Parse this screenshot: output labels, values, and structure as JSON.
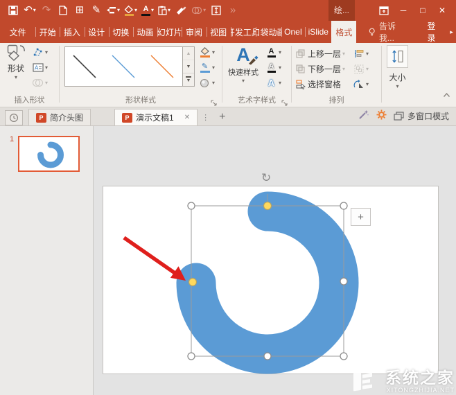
{
  "window": {
    "context_tab_title": "绘...",
    "controls": {
      "minimize": "─",
      "maximize": "□",
      "close": "✕"
    }
  },
  "icons": {
    "dropdown": "▾",
    "undo": "↶",
    "redo": "↷",
    "grid": "⊞",
    "eyedropper": "✎",
    "pencil": "✎",
    "chevrons": "»",
    "scroll_up": "▲",
    "scroll_down": "▼",
    "rotate": "↻",
    "plus": "+",
    "add_tab": "+",
    "close_tab": "✕",
    "more_vert": "⋮",
    "arrow_right": "▸",
    "collapse": "⌃",
    "letter_a": "A"
  },
  "menu": {
    "file": "文件",
    "tabs": [
      "开始",
      "插入",
      "设计",
      "切换",
      "动画",
      "幻灯片",
      "审阅",
      "视图",
      "开发工具",
      "口袋动画",
      "OneI",
      "iSlide"
    ],
    "active_tab": "格式",
    "tell_me": "告诉我...",
    "sign_in": "登录"
  },
  "ribbon": {
    "insert_shapes": {
      "label": "插入形状",
      "shapes_button": "形状"
    },
    "shape_styles": {
      "label": "形状样式"
    },
    "wordart": {
      "label": "艺术字样式",
      "quick_styles": "快速样式"
    },
    "arrange": {
      "label": "排列",
      "bring_forward": "上移一层",
      "send_backward": "下移一层",
      "selection_pane": "选择窗格"
    },
    "size": {
      "label": "大小"
    }
  },
  "tabbar": {
    "documents": [
      {
        "label": "简介头图"
      },
      {
        "label": "演示文稿1"
      }
    ],
    "multi_window": "多窗口模式"
  },
  "thumbnail_panel": {
    "slide_number": "1"
  },
  "watermark": {
    "name": "系统之家",
    "site": "XITONGZHIJIA.NET"
  },
  "colors": {
    "titlebar_red": "#C1492C",
    "active_tab_text": "#BE4B2F",
    "shape_blue": "#5B9BD5",
    "handle_yellow": "#FFD95E",
    "arrow_red": "#DF1F1C",
    "thumbnail_border": "#E25B36",
    "gallery_line_black": "#3f3f3f",
    "gallery_line_blue": "#5B9BD5",
    "gallery_line_orange": "#ED7D31"
  }
}
